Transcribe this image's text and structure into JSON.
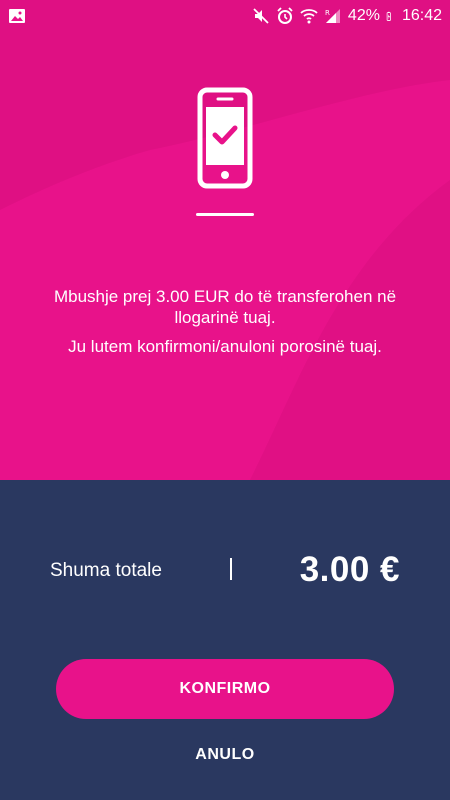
{
  "status_bar": {
    "battery_percent": "42%",
    "time": "16:42",
    "icons": [
      "image-icon",
      "mute-icon",
      "alarm-icon",
      "wifi-icon",
      "signal-icon",
      "battery-icon"
    ]
  },
  "message": {
    "line1": "Mbushje prej 3.00 EUR do të transferohen në llogarinë tuaj.",
    "line2": "Ju lutem konfirmoni/anuloni porosinë tuaj."
  },
  "summary": {
    "label": "Shuma totale",
    "amount": "3.00 €"
  },
  "actions": {
    "confirm_label": "KONFIRMO",
    "cancel_label": "ANULO"
  },
  "colors": {
    "primary_pink": "#e8128a",
    "navy": "#2a3860",
    "white": "#ffffff"
  }
}
